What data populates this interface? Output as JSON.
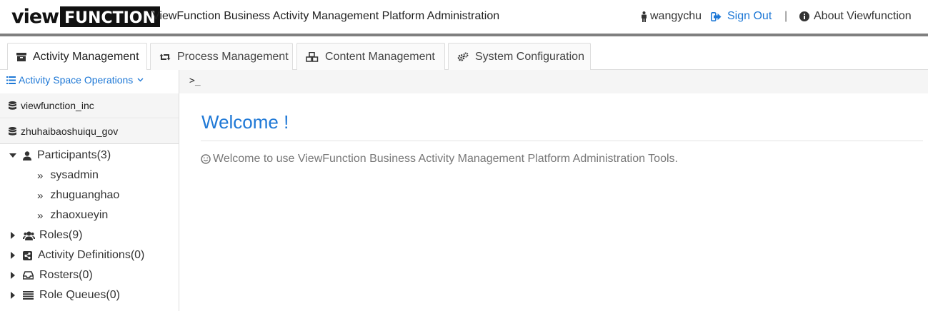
{
  "header": {
    "logo_part1": "view",
    "logo_part2": "FUNCTION",
    "title": "ViewFunction Business Activity Management Platform Administration",
    "user_name": "wangychu",
    "sign_out": "Sign Out",
    "separator": "|",
    "about": "About Viewfunction"
  },
  "tabs": [
    {
      "label": "Activity Management",
      "icon": "archive-icon",
      "active": true
    },
    {
      "label": "Process Management",
      "icon": "retweet-icon",
      "active": false
    },
    {
      "label": "Content Management",
      "icon": "cubes-icon",
      "active": false
    },
    {
      "label": "System Configuration",
      "icon": "cogs-icon",
      "active": false
    }
  ],
  "sidebar": {
    "space_ops_label": "Activity Space Operations",
    "spaces": [
      {
        "label": "viewfunction_inc",
        "icon": "database-icon"
      },
      {
        "label": "zhuhaibaoshuiqu_gov",
        "icon": "database-icon"
      }
    ],
    "tree": [
      {
        "label": "Participants(3)",
        "icon": "user-icon",
        "expanded": true,
        "children": [
          "sysadmin",
          "zhuguanghao",
          "zhaoxueyin"
        ]
      },
      {
        "label": "Roles(9)",
        "icon": "users-icon",
        "expanded": false
      },
      {
        "label": "Activity Definitions(0)",
        "icon": "share-square-icon",
        "expanded": false
      },
      {
        "label": "Rosters(0)",
        "icon": "inbox-icon",
        "expanded": false
      },
      {
        "label": "Role Queues(0)",
        "icon": "list-icon",
        "expanded": false
      }
    ]
  },
  "main": {
    "prompt": ">_",
    "welcome_title": "Welcome !",
    "welcome_message": "Welcome to use ViewFunction Business Activity Management Platform Administration Tools."
  },
  "colors": {
    "accent": "#1e78d6",
    "header_bar": "#7f7f7f",
    "panel_bg": "#f5f5f5"
  }
}
